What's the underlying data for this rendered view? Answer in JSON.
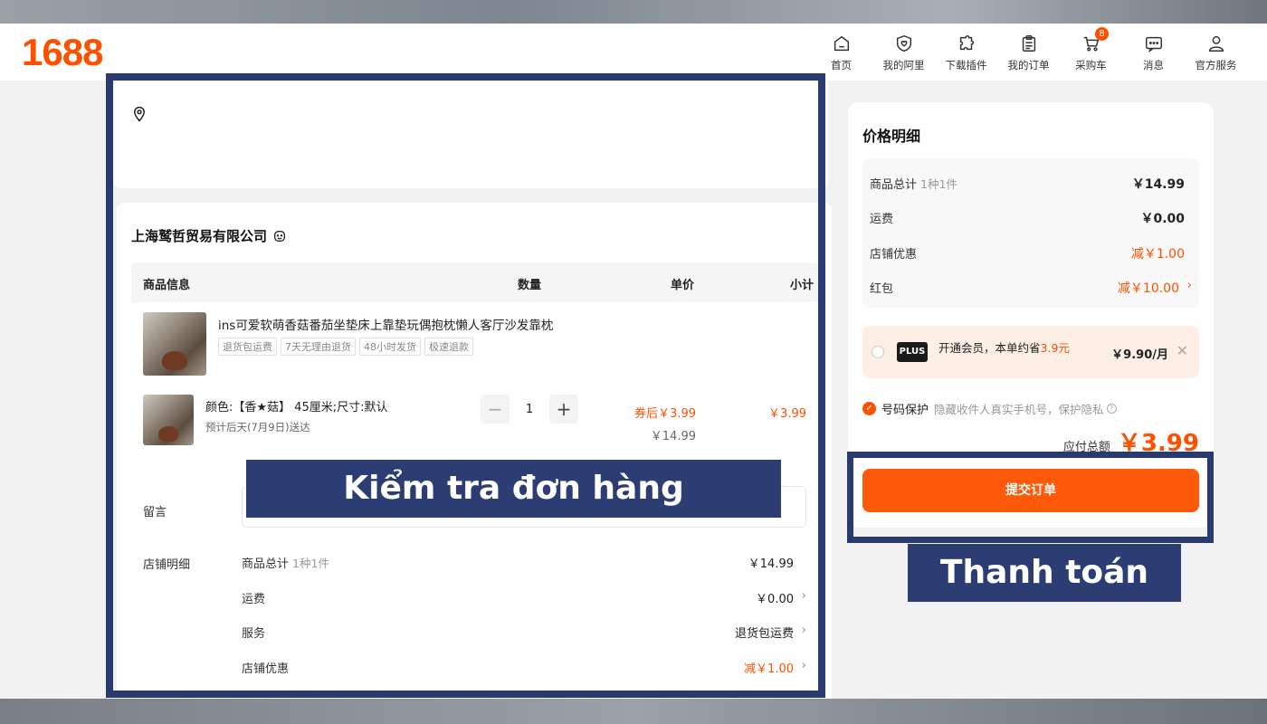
{
  "header": {
    "logo": "1688",
    "nav": [
      {
        "label": "首页",
        "icon": "home-icon"
      },
      {
        "label": "我的阿里",
        "icon": "heart-shield-icon"
      },
      {
        "label": "下载插件",
        "icon": "puzzle-icon"
      },
      {
        "label": "我的订单",
        "icon": "clipboard-icon"
      },
      {
        "label": "采购车",
        "icon": "cart-icon",
        "badge": "8"
      },
      {
        "label": "消息",
        "icon": "message-icon"
      },
      {
        "label": "官方服务",
        "icon": "user-icon"
      }
    ]
  },
  "order": {
    "shop_name": "上海鹫哲贸易有限公司",
    "columns": {
      "info": "商品信息",
      "qty": "数量",
      "unit": "单价",
      "subtotal": "小计"
    },
    "product": {
      "title": "ins可爱软萌香菇番茄坐垫床上靠垫玩偶抱枕懒人客厅沙发靠枕",
      "tags": [
        "退货包运费",
        "7天无理由退货",
        "48小时发货",
        "极速退款"
      ],
      "sku": "颜色:【香★菇】 45厘米;尺寸:默认",
      "eta": "预计后天(7月9日)送达",
      "quantity": "1",
      "coupon_price": "券后￥3.99",
      "original_price": "￥14.99",
      "subtotal": "￥3.99"
    },
    "note_label": "留言",
    "detail_label": "店铺明细",
    "details": [
      {
        "key": "商品总计",
        "sub": "1种1件",
        "value": "￥14.99"
      },
      {
        "key": "运费",
        "sub": "",
        "value": "￥0.00"
      },
      {
        "key": "服务",
        "sub": "",
        "value": "退货包运费"
      },
      {
        "key": "店铺优惠",
        "sub": "",
        "value": "减￥1.00"
      }
    ]
  },
  "sidebar": {
    "title": "价格明细",
    "rows": [
      {
        "key": "商品总计",
        "sub": "1种1件",
        "value": "￥14.99"
      },
      {
        "key": "运费",
        "sub": "",
        "value": "￥0.00"
      },
      {
        "key": "店铺优惠",
        "sub": "",
        "value": "减￥1.00"
      },
      {
        "key": "红包",
        "sub": "",
        "value": "减￥10.00"
      }
    ],
    "plus": {
      "logo": "PLUS",
      "text_pre": "开通会员，本单约省",
      "saving": "3.9元",
      "price": "￥9.90/月"
    },
    "privacy": {
      "label": "号码保护",
      "desc": "隐藏收件人真实手机号，保护隐私"
    },
    "total_label": "应付总额",
    "total_value": "￥3.99",
    "submit_label": "提交订单"
  },
  "overlays": {
    "left_caption": "Kiểm tra đơn hàng",
    "right_caption": "Thanh toán"
  },
  "colors": {
    "brand": "#ff5000",
    "highlight": "#283a70"
  }
}
